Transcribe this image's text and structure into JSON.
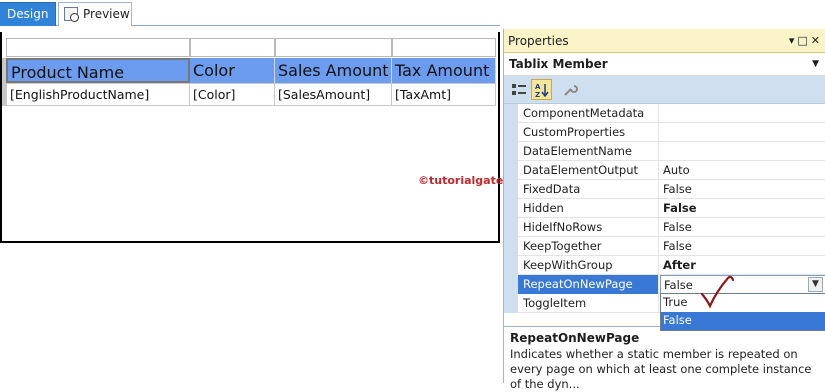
{
  "tabs": [
    {
      "label": "Design",
      "active": true
    },
    {
      "label": "Preview",
      "active": false
    }
  ],
  "tablix": {
    "headers": [
      "Product Name",
      "Color",
      "Sales Amount",
      "Tax Amount"
    ],
    "row": [
      "[EnglishProductName]",
      "[Color]",
      "[SalesAmount]",
      "[TaxAmt]"
    ],
    "header_color": "#6b9cf0"
  },
  "watermark": "©tutorialgateway.org",
  "properties": {
    "title": "Properties",
    "object": "Tablix Member",
    "rows": [
      {
        "name": "ComponentMetadata",
        "value": "",
        "bold": false
      },
      {
        "name": "CustomProperties",
        "value": "",
        "bold": false
      },
      {
        "name": "DataElementName",
        "value": "",
        "bold": false
      },
      {
        "name": "DataElementOutput",
        "value": "Auto",
        "bold": false
      },
      {
        "name": "FixedData",
        "value": "False",
        "bold": false
      },
      {
        "name": "Hidden",
        "value": "False",
        "bold": true
      },
      {
        "name": "HideIfNoRows",
        "value": "False",
        "bold": false
      },
      {
        "name": "KeepTogether",
        "value": "False",
        "bold": false
      },
      {
        "name": "KeepWithGroup",
        "value": "After",
        "bold": true
      },
      {
        "name": "RepeatOnNewPage",
        "value": "False",
        "bold": false,
        "selected": true
      },
      {
        "name": "ToggleItem",
        "value": "",
        "bold": false
      }
    ],
    "dropdown_options": [
      "True",
      "False"
    ],
    "dropdown_highlighted": "False",
    "help_title": "RepeatOnNewPage",
    "help_desc": "Indicates whether a static member is repeated on every page on which at least one complete instance of the dyn..."
  },
  "colors": {
    "selection": "#3a78d6",
    "title_bar": "#fbf3c8",
    "toolbar": "#cfdff0",
    "watermark": "#c0282a"
  }
}
